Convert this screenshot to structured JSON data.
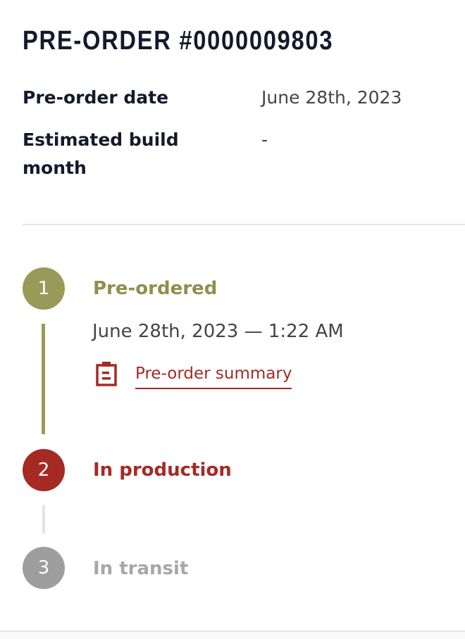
{
  "order": {
    "title": "PRE-ORDER #0000009803",
    "details": [
      {
        "label": "Pre-order date",
        "value": "June 28th, 2023"
      },
      {
        "label": "Estimated build month",
        "value": "-"
      }
    ]
  },
  "timeline": {
    "steps": [
      {
        "number": "1",
        "title": "Pre-ordered",
        "date": "June 28th, 2023 — 1:22 AM",
        "link_label": "Pre-order summary",
        "link_icon": "clipboard-icon",
        "status": "complete"
      },
      {
        "number": "2",
        "title": "In production",
        "status": "current"
      },
      {
        "number": "3",
        "title": "In transit",
        "status": "upcoming"
      }
    ]
  },
  "colors": {
    "complete": "#9a9a58",
    "current": "#a52a24",
    "upcoming": "#9e9e9e",
    "heading": "#121a2b"
  }
}
